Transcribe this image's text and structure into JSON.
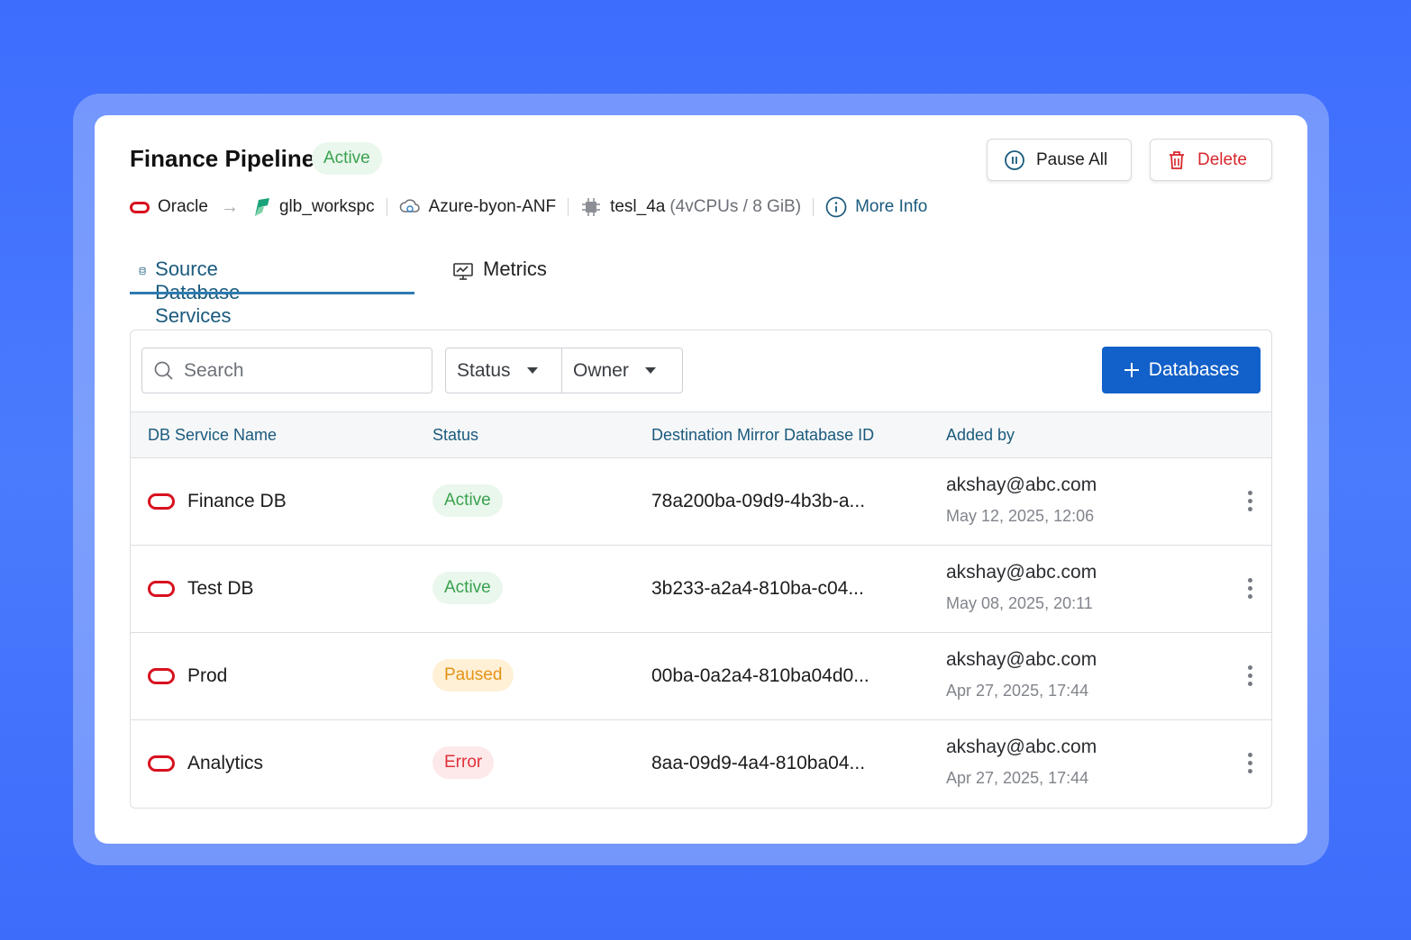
{
  "header": {
    "title": "Finance Pipeline",
    "status": "Active",
    "pause_label": "Pause All",
    "delete_label": "Delete"
  },
  "meta": {
    "source": "Oracle",
    "workspace": "glb_workspc",
    "storage": "Azure-byon-ANF",
    "compute_name": "tesl_4a",
    "compute_spec": "(4vCPUs / 8 GiB)",
    "more_info": "More Info"
  },
  "tabs": [
    {
      "label": "Source Database Services",
      "icon": "database-icon",
      "active": true
    },
    {
      "label": "Metrics",
      "icon": "monitor-chart-icon",
      "active": false
    }
  ],
  "toolbar": {
    "search_placeholder": "Search",
    "filter_status": "Status",
    "filter_owner": "Owner",
    "add_label": "Databases"
  },
  "table": {
    "columns": [
      "DB Service Name",
      "Status",
      "Destination Mirror Database ID",
      "Added by"
    ],
    "rows": [
      {
        "name": "Finance DB",
        "status": "Active",
        "status_type": "active",
        "dest": "78a200ba-09d9-4b3b-a...",
        "email": "akshay@abc.com",
        "date": "May 12, 2025,  12:06"
      },
      {
        "name": "Test DB",
        "status": "Active",
        "status_type": "active",
        "dest": "3b233-a2a4-810ba-c04...",
        "email": "akshay@abc.com",
        "date": "May 08, 2025,  20:11"
      },
      {
        "name": "Prod",
        "status": "Paused",
        "status_type": "paused",
        "dest": "00ba-0a2a4-810ba04d0...",
        "email": "akshay@abc.com",
        "date": "Apr 27, 2025,  17:44"
      },
      {
        "name": "Analytics",
        "status": "Error",
        "status_type": "error",
        "dest": "8aa-09d9-4a4-810ba04...",
        "email": "akshay@abc.com",
        "date": "Apr 27, 2025,  17:44"
      }
    ]
  },
  "colors": {
    "background": "#3d6dfd",
    "primary": "#1260c9",
    "link": "#1a5a7d",
    "oracle": "#d8111f",
    "active": "#3aa14f",
    "paused": "#e39418",
    "error": "#e0313a"
  }
}
